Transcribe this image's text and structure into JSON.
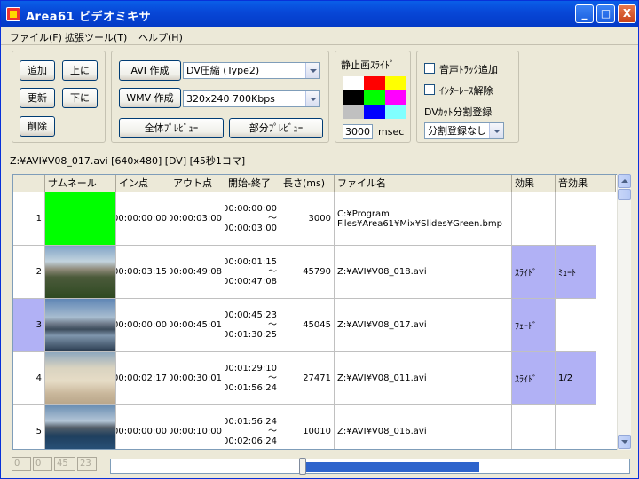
{
  "window": {
    "title": "Area61 ビデオミキサ",
    "minimize": "_",
    "maximize": "□",
    "close": "X"
  },
  "menu": [
    "ファイル(F)",
    "拡張ツール(T)",
    "ヘルプ(H)"
  ],
  "buttons": {
    "add": "追加",
    "up": "上に",
    "update": "更新",
    "down": "下に",
    "delete": "削除",
    "avi_create": "AVI 作成",
    "wmv_create": "WMV 作成",
    "full_preview": "全体ﾌﾟﾚﾋﾞｭｰ",
    "partial_preview": "部分ﾌﾟﾚﾋﾞｭｰ"
  },
  "selects": {
    "avi_codec": "DV圧縮 (Type2)",
    "wmv_profile": "320x240 700Kbps",
    "dv_split": "分割登録なし"
  },
  "still_image": {
    "label": "静止画ｽﾗｲﾄﾞ",
    "colors": [
      "#ffffff",
      "#ff0000",
      "#ffff00",
      "#000000",
      "#00ff00",
      "#ff00ff",
      "#c0c0c0",
      "#0000ff",
      "#80ffff"
    ],
    "duration": "3000",
    "unit": "msec"
  },
  "options": {
    "add_audio_track": "音声ﾄﾗｯｸ追加",
    "deinterlace": "ｲﾝﾀｰﾚｰｽ解除",
    "dv_cut_label": "DVｶｯﾄ分割登録"
  },
  "current_file": "Z:¥AVI¥V08_017.avi [640x480] [DV] [45秒1コマ]",
  "table": {
    "headers": [
      "",
      "サムネール",
      "イン点",
      "アウト点",
      "開始-終了",
      "長さ(ms)",
      "ファイル名",
      "効果",
      "音効果"
    ],
    "rows": [
      {
        "no": "1",
        "thumb": "green",
        "in": "00:00:00:00",
        "out": "00:00:03:00",
        "start": "00:00:00:00",
        "sep": "～",
        "end": "00:00:03:00",
        "length": "3000",
        "file1": "C:¥Program",
        "file2": "Files¥Area61¥Mix¥Slides¥Green.bmp",
        "effect": "",
        "sound": ""
      },
      {
        "no": "2",
        "thumb": "mountain",
        "in": "00:00:03:15",
        "out": "00:00:49:08",
        "start": "00:00:01:15",
        "sep": "～",
        "end": "00:00:47:08",
        "length": "45790",
        "file1": "Z:¥AVI¥V08_018.avi",
        "file2": "",
        "effect": "ｽﾗｲﾄﾞ",
        "sound": "ﾐｭｰﾄ"
      },
      {
        "no": "3",
        "thumb": "lake",
        "in": "00:00:00:00",
        "out": "00:00:45:01",
        "start": "00:00:45:23",
        "sep": "～",
        "end": "00:01:30:25",
        "length": "45045",
        "file1": "Z:¥AVI¥V08_017.avi",
        "file2": "",
        "effect": "ﾌｪｰﾄﾞ",
        "sound": ""
      },
      {
        "no": "4",
        "thumb": "beach",
        "in": "00:00:02:17",
        "out": "00:00:30:01",
        "start": "00:01:29:10",
        "sep": "～",
        "end": "00:01:56:24",
        "length": "27471",
        "file1": "Z:¥AVI¥V08_011.avi",
        "file2": "",
        "effect": "ｽﾗｲﾄﾞ",
        "sound": "1/2"
      },
      {
        "no": "5",
        "thumb": "sea",
        "in": "00:00:00:00",
        "out": "00:00:10:00",
        "start": "00:01:56:24",
        "sep": "～",
        "end": "00:02:06:24",
        "length": "10010",
        "file1": "Z:¥AVI¥V08_016.avi",
        "file2": "",
        "effect": "",
        "sound": ""
      }
    ]
  },
  "status_fields": [
    "0",
    "0",
    "45",
    "23"
  ],
  "playback": {
    "position_fraction": 0.37,
    "range_start_fraction": 0.37,
    "range_end_fraction": 0.71
  }
}
